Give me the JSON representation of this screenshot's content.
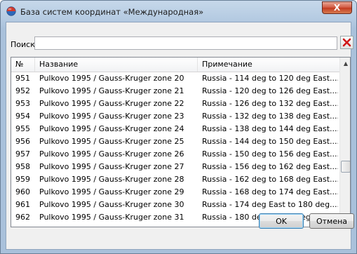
{
  "window": {
    "title": "База систем координат «Международная»",
    "close_label": "X"
  },
  "search": {
    "label": "Поиск",
    "value": "",
    "clear_label": "×"
  },
  "table": {
    "columns": [
      "№",
      "Название",
      "Примечание"
    ],
    "rows": [
      {
        "num": "951",
        "name": "Pulkovo 1995 / Gauss-Kruger zone 20",
        "note": "Russia - 114 deg to 120 deg East...."
      },
      {
        "num": "952",
        "name": "Pulkovo 1995 / Gauss-Kruger zone 21",
        "note": "Russia - 120 deg to 126 deg East...."
      },
      {
        "num": "953",
        "name": "Pulkovo 1995 / Gauss-Kruger zone 22",
        "note": "Russia - 126 deg to 132 deg East...."
      },
      {
        "num": "954",
        "name": "Pulkovo 1995 / Gauss-Kruger zone 23",
        "note": "Russia - 132 deg to 138 deg East...."
      },
      {
        "num": "955",
        "name": "Pulkovo 1995 / Gauss-Kruger zone 24",
        "note": "Russia - 138 deg to 144 deg East...."
      },
      {
        "num": "956",
        "name": "Pulkovo 1995 / Gauss-Kruger zone 25",
        "note": "Russia - 144 deg to 150 deg East...."
      },
      {
        "num": "957",
        "name": "Pulkovo 1995 / Gauss-Kruger zone 26",
        "note": "Russia - 150 deg to 156 deg East...."
      },
      {
        "num": "958",
        "name": "Pulkovo 1995 / Gauss-Kruger zone 27",
        "note": "Russia - 156 deg to 162 deg East...."
      },
      {
        "num": "959",
        "name": "Pulkovo 1995 / Gauss-Kruger zone 28",
        "note": "Russia - 162 deg to 168 deg East...."
      },
      {
        "num": "960",
        "name": "Pulkovo 1995 / Gauss-Kruger zone 29",
        "note": "Russia - 168 deg to 174 deg East...."
      },
      {
        "num": "961",
        "name": "Pulkovo 1995 / Gauss-Kruger zone 30",
        "note": "Russia - 174 deg East to 180 deg...."
      },
      {
        "num": "962",
        "name": "Pulkovo 1995 / Gauss-Kruger zone 31",
        "note": "Russia - 180 deg to 174 deg West...."
      }
    ]
  },
  "buttons": {
    "ok": "OK",
    "cancel": "Отмена"
  },
  "icons": {
    "app": "globe-icon",
    "clear": "red-x-icon",
    "close": "close-icon"
  },
  "colors": {
    "clear_x": "#d01818",
    "close_button": "#c9452d"
  }
}
